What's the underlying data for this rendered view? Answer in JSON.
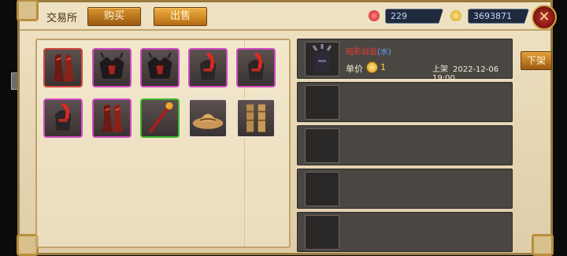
{
  "header": {
    "title": "交易所",
    "tabs": [
      {
        "label": "购买"
      },
      {
        "label": "出售"
      }
    ],
    "currency_gem": "229",
    "currency_gold": "3693871"
  },
  "inventory": [
    {
      "name": "red-greaves-item",
      "quality": "red"
    },
    {
      "name": "dark-chest-armor-item",
      "quality": "purple"
    },
    {
      "name": "dark-chest-armor-item",
      "quality": "purple"
    },
    {
      "name": "plumed-helmet-item",
      "quality": "purple"
    },
    {
      "name": "plumed-helmet-item",
      "quality": "purple"
    },
    {
      "name": "plumed-helmet-item",
      "quality": "purple"
    },
    {
      "name": "red-greaves-item",
      "quality": "purple"
    },
    {
      "name": "fire-staff-item",
      "quality": "green"
    },
    {
      "name": "straw-hat-item",
      "quality": "white"
    },
    {
      "name": "leather-boots-item",
      "quality": "white"
    }
  ],
  "listings": [
    {
      "name": "暗影战盔",
      "element": "(水)",
      "price_label": "单价",
      "price": "1",
      "listed_label": "上架",
      "listed_at": "2022-12-06 19:00"
    },
    {},
    {},
    {},
    {}
  ],
  "actions": {
    "unlist_label": "下架"
  },
  "colors": {
    "red": "#d2463c",
    "purple": "#d04bc3",
    "green": "#3fb72e",
    "white": "#e8e1d0"
  }
}
